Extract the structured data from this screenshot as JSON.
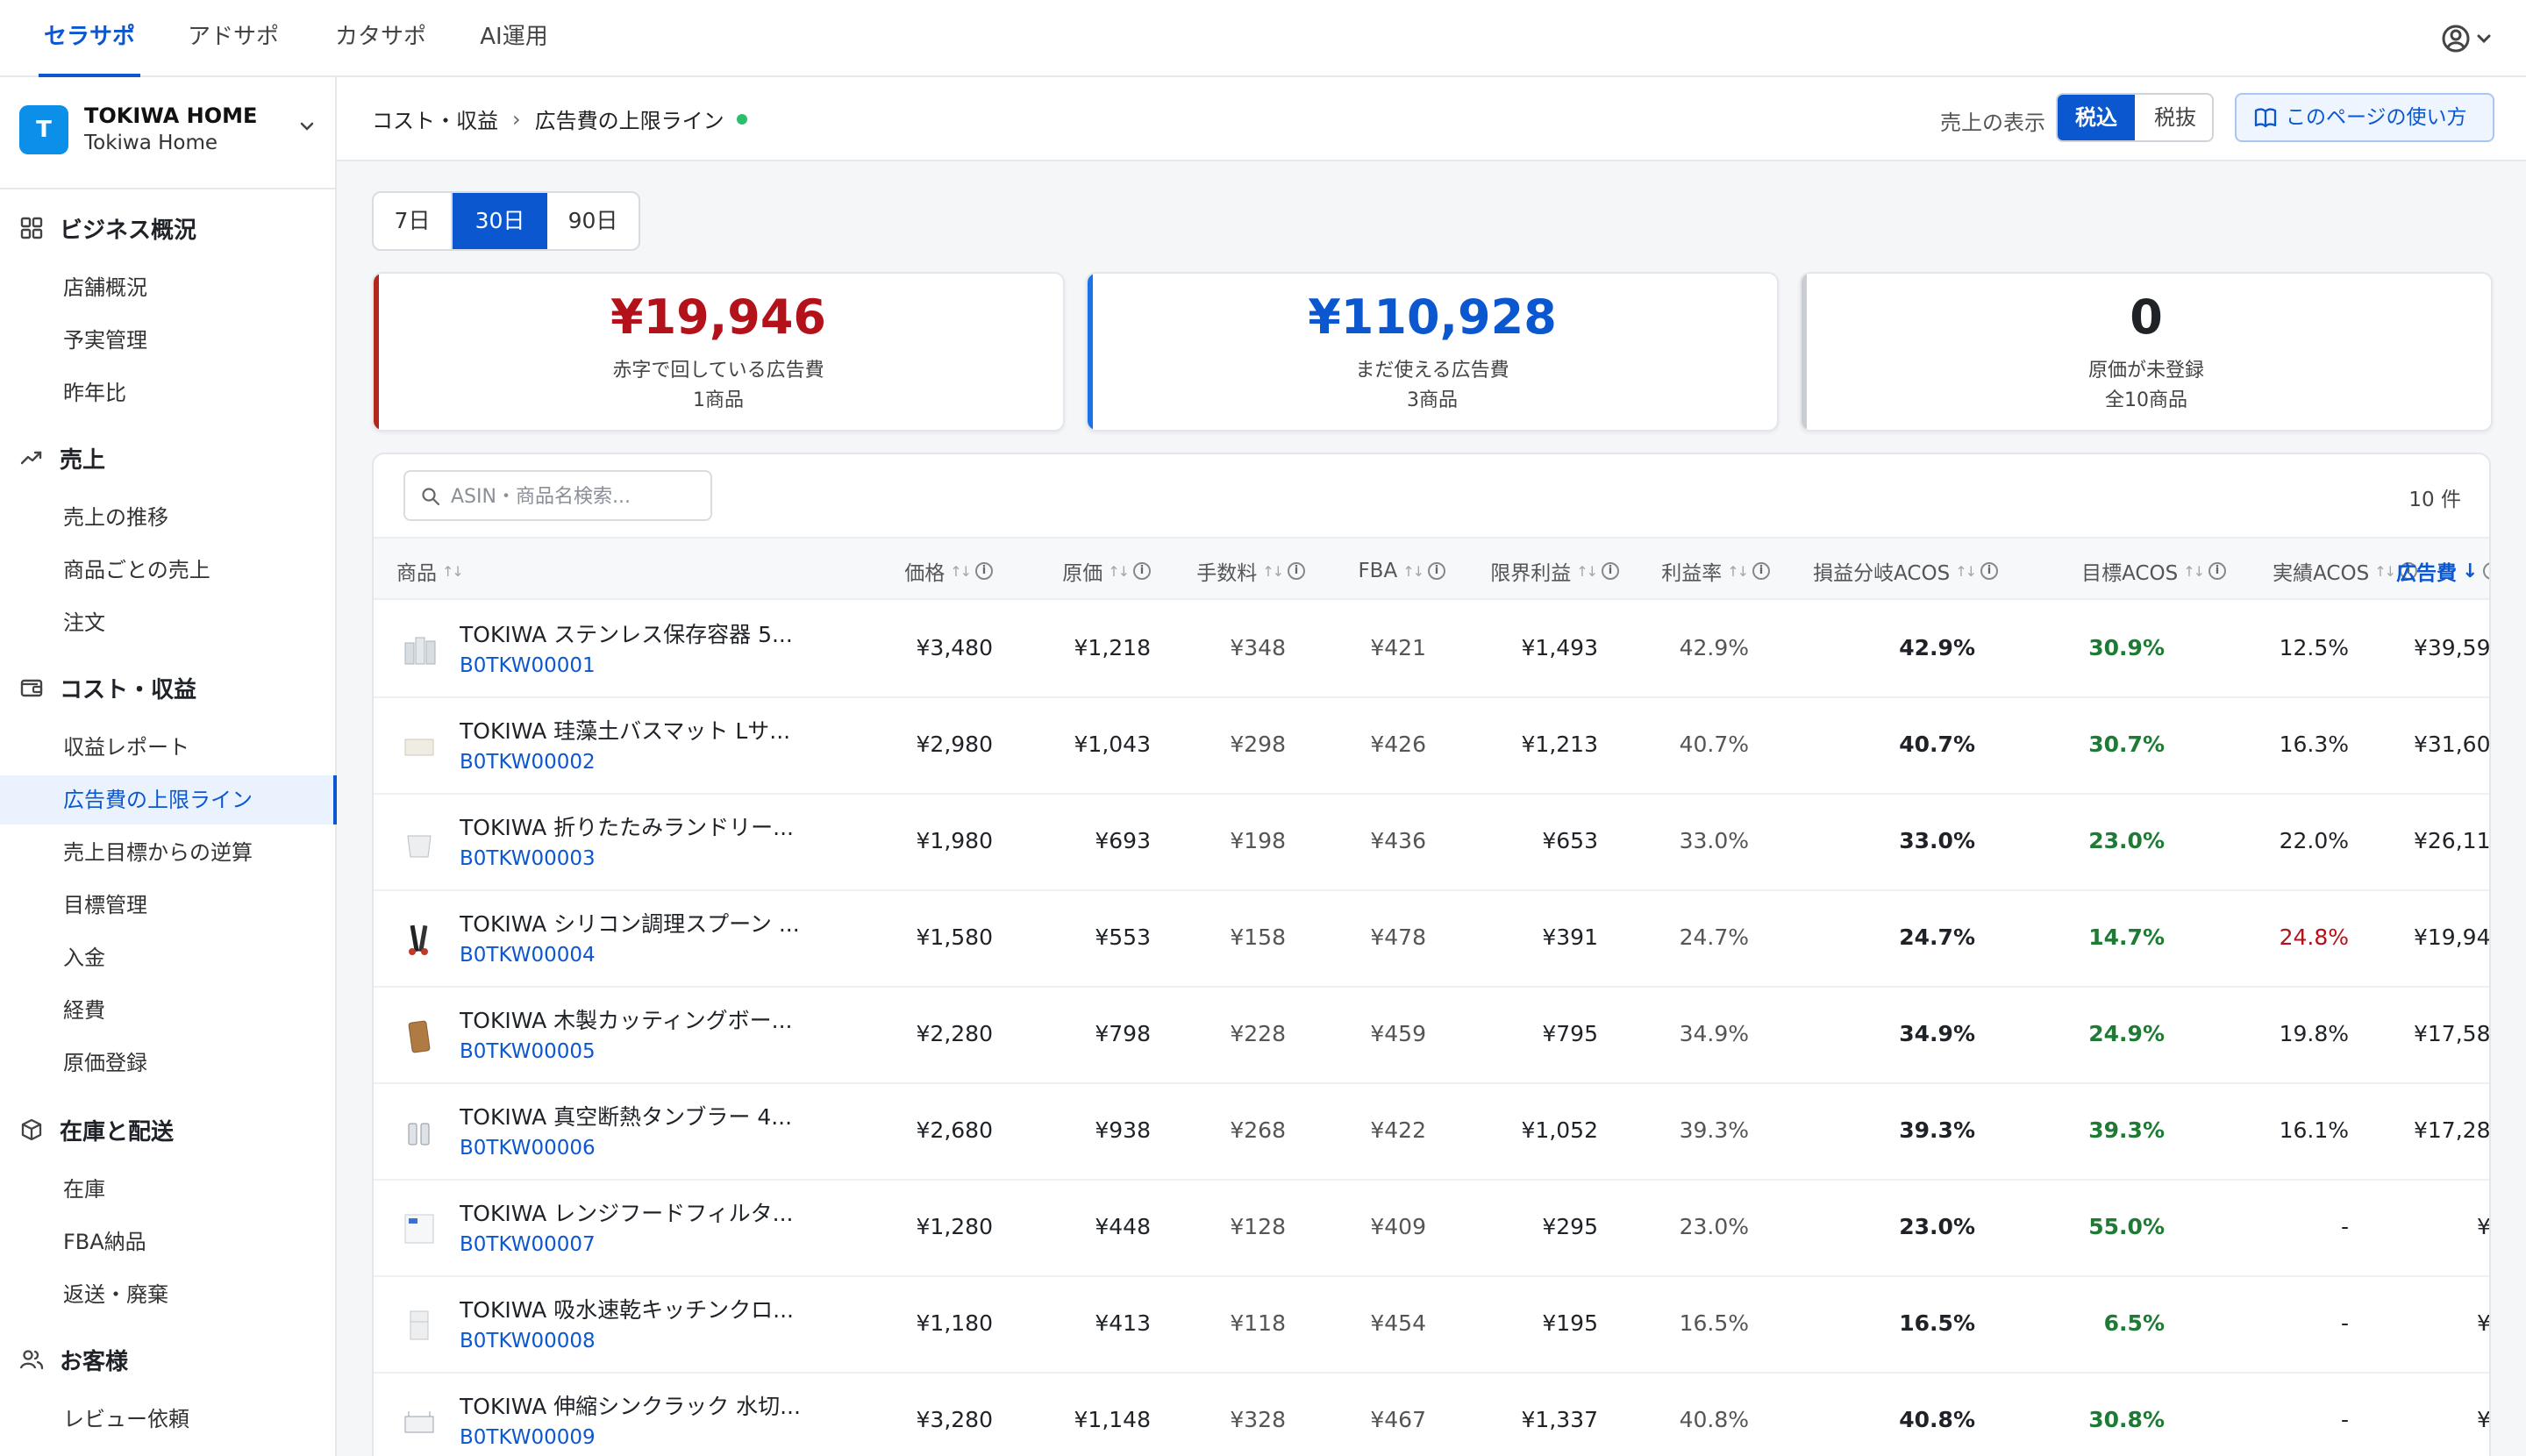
{
  "top_nav": {
    "tabs": [
      {
        "label": "セラサポ",
        "active": true
      },
      {
        "label": "アドサポ"
      },
      {
        "label": "カタサポ"
      },
      {
        "label": "AI運用"
      }
    ]
  },
  "store": {
    "initial": "T",
    "name": "TOKIWA HOME",
    "sub": "Tokiwa Home"
  },
  "sidebar": {
    "sections": [
      {
        "title": "ビジネス概況",
        "icon": "grid-icon",
        "items": [
          "店舗概況",
          "予実管理",
          "昨年比"
        ]
      },
      {
        "title": "売上",
        "icon": "trending-up-icon",
        "items": [
          "売上の推移",
          "商品ごとの売上",
          "注文"
        ]
      },
      {
        "title": "コスト・収益",
        "icon": "wallet-icon",
        "items": [
          "収益レポート",
          "広告費の上限ライン",
          "売上目標からの逆算",
          "目標管理",
          "入金",
          "経費",
          "原価登録"
        ]
      },
      {
        "title": "在庫と配送",
        "icon": "box-icon",
        "items": [
          "在庫",
          "FBA納品",
          "返送・廃棄"
        ]
      },
      {
        "title": "お客様",
        "icon": "users-icon",
        "items": [
          "レビュー依頼"
        ]
      }
    ],
    "active_item": "広告費の上限ライン"
  },
  "breadcrumb": {
    "parent": "コスト・収益",
    "separator": "›",
    "current": "広告費の上限ライン"
  },
  "tax_display": {
    "label": "売上の表示",
    "options": [
      "税込",
      "税抜"
    ],
    "selected": "税込"
  },
  "help_button": "このページの使い方",
  "periods": {
    "options": [
      "7日",
      "30日",
      "90日"
    ],
    "selected": "30日"
  },
  "summary_cards": [
    {
      "value": "¥19,946",
      "label": "赤字で回している広告費",
      "sub": "1商品",
      "accent": "#b3121b"
    },
    {
      "value": "¥110,928",
      "label": "まだ使える広告費",
      "sub": "3商品",
      "accent": "#0b57d0"
    },
    {
      "value": "0",
      "label": "原価が未登録",
      "sub": "全10商品",
      "accent": "#c9ccd1"
    }
  ],
  "search": {
    "placeholder": "ASIN・商品名検索..."
  },
  "result_count": "10 件",
  "table": {
    "columns": [
      "商品",
      "価格",
      "原価",
      "手数料",
      "FBA",
      "限界利益",
      "利益率",
      "損益分岐ACOS",
      "目標ACOS",
      "実績ACOS",
      "広告費"
    ],
    "sorted_column": "広告費",
    "rows": [
      {
        "name": "TOKIWA ステンレス保存容器 5...",
        "asin": "B0TKW00001",
        "price": "¥3,480",
        "cost": "¥1,218",
        "fee": "¥348",
        "fba": "¥421",
        "margin": "¥1,493",
        "rate": "42.9%",
        "be_acos": "42.9%",
        "target_acos": "30.9%",
        "actual_acos": "12.5%",
        "ad": "¥39,59",
        "thumb": "containers"
      },
      {
        "name": "TOKIWA 珪藻土バスマット Lサ...",
        "asin": "B0TKW00002",
        "price": "¥2,980",
        "cost": "¥1,043",
        "fee": "¥298",
        "fba": "¥426",
        "margin": "¥1,213",
        "rate": "40.7%",
        "be_acos": "40.7%",
        "target_acos": "30.7%",
        "actual_acos": "16.3%",
        "ad": "¥31,60",
        "thumb": "mat"
      },
      {
        "name": "TOKIWA 折りたたみランドリー...",
        "asin": "B0TKW00003",
        "price": "¥1,980",
        "cost": "¥693",
        "fee": "¥198",
        "fba": "¥436",
        "margin": "¥653",
        "rate": "33.0%",
        "be_acos": "33.0%",
        "target_acos": "23.0%",
        "actual_acos": "22.0%",
        "ad": "¥26,11",
        "thumb": "basket"
      },
      {
        "name": "TOKIWA シリコン調理スプーン ...",
        "asin": "B0TKW00004",
        "price": "¥1,580",
        "cost": "¥553",
        "fee": "¥158",
        "fba": "¥478",
        "margin": "¥391",
        "rate": "24.7%",
        "be_acos": "24.7%",
        "target_acos": "14.7%",
        "actual_acos": "24.8%",
        "ad": "¥19,94",
        "thumb": "spoons",
        "actual_over": true
      },
      {
        "name": "TOKIWA 木製カッティングボー...",
        "asin": "B0TKW00005",
        "price": "¥2,280",
        "cost": "¥798",
        "fee": "¥228",
        "fba": "¥459",
        "margin": "¥795",
        "rate": "34.9%",
        "be_acos": "34.9%",
        "target_acos": "24.9%",
        "actual_acos": "19.8%",
        "ad": "¥17,58",
        "thumb": "board"
      },
      {
        "name": "TOKIWA 真空断熱タンブラー 4...",
        "asin": "B0TKW00006",
        "price": "¥2,680",
        "cost": "¥938",
        "fee": "¥268",
        "fba": "¥422",
        "margin": "¥1,052",
        "rate": "39.3%",
        "be_acos": "39.3%",
        "target_acos": "39.3%",
        "actual_acos": "16.1%",
        "ad": "¥17,28",
        "thumb": "tumblers"
      },
      {
        "name": "TOKIWA レンジフードフィルタ...",
        "asin": "B0TKW00007",
        "price": "¥1,280",
        "cost": "¥448",
        "fee": "¥128",
        "fba": "¥409",
        "margin": "¥295",
        "rate": "23.0%",
        "be_acos": "23.0%",
        "target_acos": "55.0%",
        "actual_acos": "-",
        "ad": "¥",
        "thumb": "filter"
      },
      {
        "name": "TOKIWA 吸水速乾キッチンクロ...",
        "asin": "B0TKW00008",
        "price": "¥1,180",
        "cost": "¥413",
        "fee": "¥118",
        "fba": "¥454",
        "margin": "¥195",
        "rate": "16.5%",
        "be_acos": "16.5%",
        "target_acos": "6.5%",
        "actual_acos": "-",
        "ad": "¥",
        "thumb": "cloth"
      },
      {
        "name": "TOKIWA 伸縮シンクラック 水切...",
        "asin": "B0TKW00009",
        "price": "¥3,280",
        "cost": "¥1,148",
        "fee": "¥328",
        "fba": "¥467",
        "margin": "¥1,337",
        "rate": "40.8%",
        "be_acos": "40.8%",
        "target_acos": "30.8%",
        "actual_acos": "-",
        "ad": "¥",
        "thumb": "rack"
      }
    ]
  },
  "colors": {
    "primary": "#0b57d0",
    "loss": "#b3121b",
    "good": "#1e7a34",
    "status_dot": "#2cbf6b"
  }
}
